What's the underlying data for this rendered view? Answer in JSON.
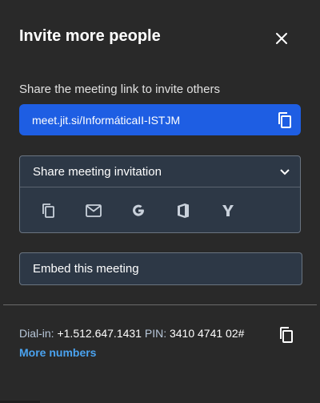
{
  "dialog": {
    "title": "Invite more people",
    "close_icon": "close-icon"
  },
  "share": {
    "label": "Share the meeting link to invite others",
    "link": "meet.jit.si/InformáticaII-ISTJM",
    "copy_icon": "copy-icon"
  },
  "invitation": {
    "header": "Share meeting invitation",
    "chevron_icon": "chevron-down-icon",
    "options": [
      {
        "name": "copy-invitation",
        "icon": "copy-icon"
      },
      {
        "name": "email",
        "icon": "mail-icon"
      },
      {
        "name": "google",
        "icon": "google-icon"
      },
      {
        "name": "outlook",
        "icon": "office-icon"
      },
      {
        "name": "yahoo",
        "icon": "yahoo-icon"
      }
    ]
  },
  "embed": {
    "label": "Embed this meeting"
  },
  "dialin": {
    "label": "Dial-in:",
    "number": "+1.512.647.1431",
    "pin_label": "PIN:",
    "pin": "3410 4741 02#",
    "more_numbers": "More numbers",
    "copy_icon": "copy-icon"
  },
  "colors": {
    "background": "#292929",
    "accent": "#1e5ee3",
    "link": "#4aa3f0",
    "panel": "#2d3846"
  }
}
